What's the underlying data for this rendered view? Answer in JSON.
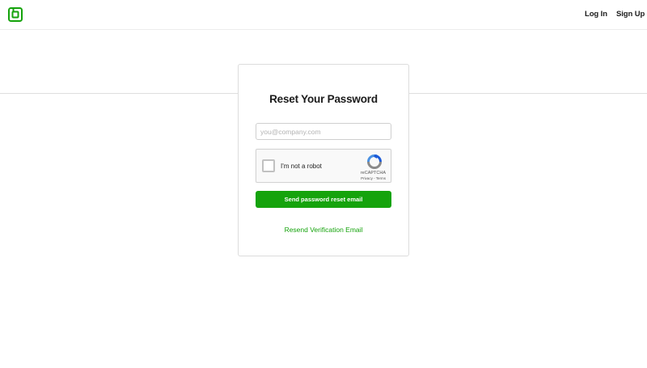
{
  "header": {
    "logo_icon": "brand-logo-icon",
    "login_label": "Log In",
    "signup_label": "Sign Up"
  },
  "form": {
    "title": "Reset Your Password",
    "email_placeholder": "you@company.com",
    "email_value": "",
    "captcha": {
      "label": "I'm not a robot",
      "brand": "reCAPTCHA",
      "privacy_label": "Privacy",
      "separator": " - ",
      "terms_label": "Terms",
      "checked": false
    },
    "submit_label": "Send password reset email",
    "resend_label": "Resend Verification Email"
  },
  "colors": {
    "brand_green": "#15a30c",
    "text": "#1b1b1b",
    "border": "#dcdcdc"
  }
}
